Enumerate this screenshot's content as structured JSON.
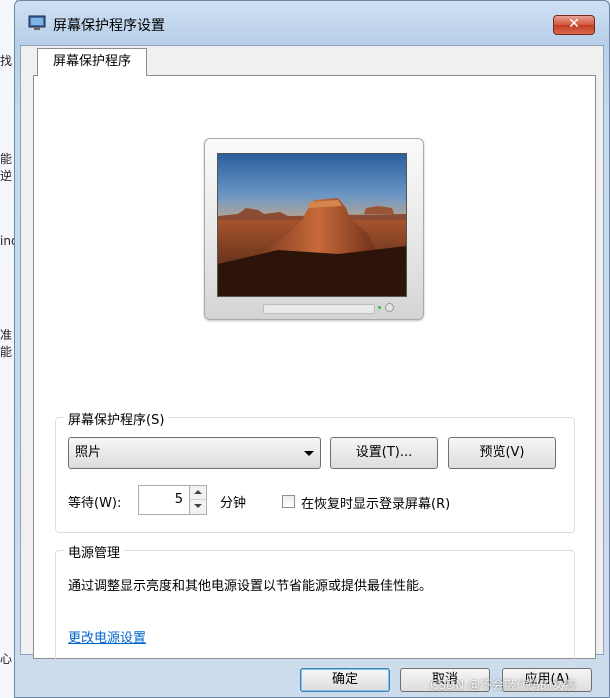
{
  "background_window": {
    "fragments": [
      "找",
      "能逆",
      "ind",
      "准能",
      "心"
    ]
  },
  "window": {
    "title": "屏幕保护程序设置",
    "close_symbol": "✕"
  },
  "tab": {
    "label": "屏幕保护程序"
  },
  "screensaver": {
    "group_label": "屏幕保护程序(S)",
    "selected": "照片",
    "settings_button": "设置(T)...",
    "preview_button": "预览(V)",
    "wait_label": "等待(W):",
    "wait_value": "5",
    "wait_unit": "分钟",
    "resume_checkbox_label": "在恢复时显示登录屏幕(R)",
    "resume_checked": false
  },
  "power": {
    "group_label": "电源管理",
    "description": "通过调整显示亮度和其他电源设置以节省能源或提供最佳性能。",
    "link": "更改电源设置"
  },
  "buttons": {
    "ok": "确定",
    "cancel": "取消",
    "apply": "应用(A)"
  },
  "watermark": "CSDN @不会敲代码的女孩"
}
